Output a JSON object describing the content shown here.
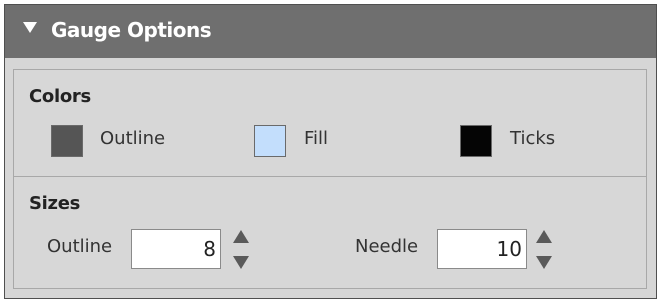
{
  "panel": {
    "title": "Gauge Options",
    "header_color": "#6f6f6f"
  },
  "colors_section": {
    "title": "Colors",
    "items": [
      {
        "label": "Outline",
        "color": "#555555"
      },
      {
        "label": "Fill",
        "color": "#c3defc"
      },
      {
        "label": "Ticks",
        "color": "#050505"
      }
    ]
  },
  "sizes_section": {
    "title": "Sizes",
    "outline": {
      "label": "Outline",
      "value": "8"
    },
    "needle": {
      "label": "Needle",
      "value": "10"
    }
  },
  "icons": {
    "collapse": "triangle-down-icon",
    "increment": "triangle-up-icon",
    "decrement": "triangle-down-icon"
  }
}
